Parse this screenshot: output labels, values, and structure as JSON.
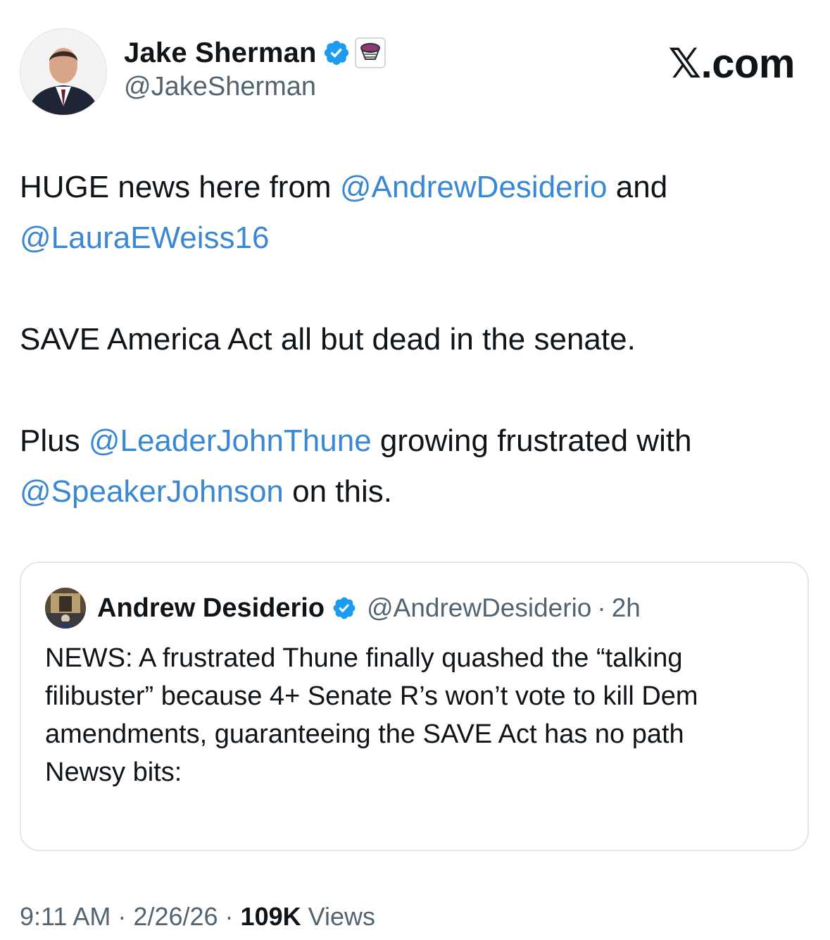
{
  "author": {
    "display_name": "Jake Sherman",
    "handle": "@JakeSherman",
    "avatar_icon": "portrait-avatar",
    "verified_icon": "verified-badge-icon",
    "affiliate_icon": "affiliate-badge-icon"
  },
  "site_logo": "𝕏.com",
  "tweet": {
    "line1_prefix": "HUGE news here from ",
    "mention1": "@AndrewDesiderio",
    "line1_suffix": " and",
    "mention2": "@LauraEWeiss16",
    "line3": "SAVE America Act all but dead in the senate.",
    "line5_prefix": "Plus ",
    "mention3": "@LeaderJohnThune",
    "line5_suffix": " growing frustrated with",
    "mention4": "@SpeakerJohnson",
    "line6_suffix": " on this."
  },
  "quoted_tweet": {
    "display_name": "Andrew Desiderio",
    "handle": "@AndrewDesiderio",
    "separator": "·",
    "time": "2h",
    "text": "NEWS: A frustrated Thune finally quashed the “talking filibuster” because 4+ Senate R’s won’t vote to kill Dem amendments, guaranteeing the SAVE Act has no path\nNewsy bits:"
  },
  "footer": {
    "time": "9:11 AM",
    "sep1": " · ",
    "date": "2/26/26",
    "sep2": " · ",
    "views_count": "109K",
    "views_label": " Views"
  },
  "colors": {
    "mention": "#3a88d4",
    "verified": "#1d9bf0",
    "secondary_text": "#536471",
    "primary_text": "#0f1419"
  }
}
